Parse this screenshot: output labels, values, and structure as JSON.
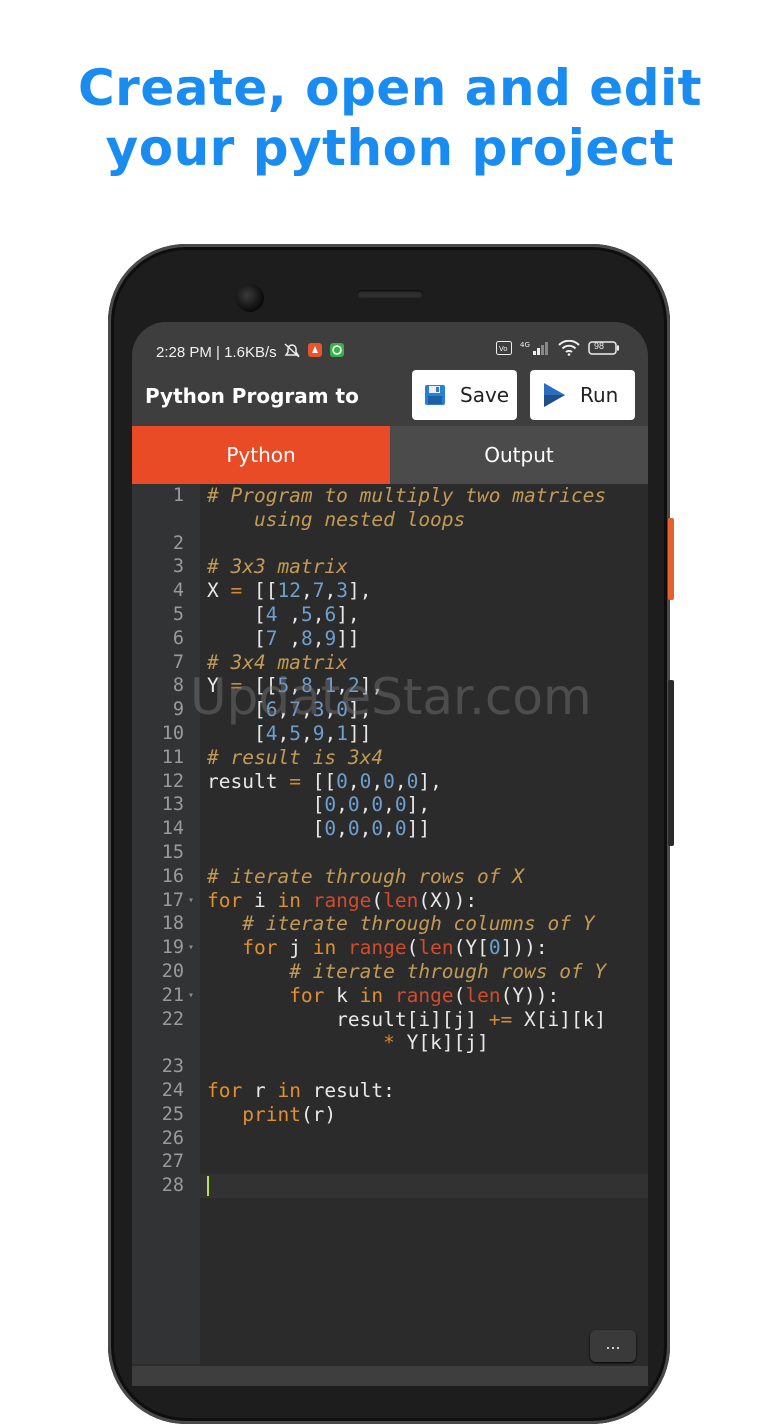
{
  "headline": {
    "line1": "Create, open and edit",
    "line2": "your python project"
  },
  "status_bar": {
    "time_speed": "2:28 PM | 1.6KB/s",
    "network": "4G",
    "battery": "98"
  },
  "toolbar": {
    "title": "Python Program to",
    "save_label": "Save",
    "run_label": "Run"
  },
  "tabs": {
    "python": "Python",
    "output": "Output"
  },
  "editor": {
    "line_numbers": [
      "1",
      "2",
      "3",
      "4",
      "5",
      "6",
      "7",
      "8",
      "9",
      "10",
      "11",
      "12",
      "13",
      "14",
      "15",
      "16",
      "17",
      "18",
      "19",
      "20",
      "21",
      "22",
      "23",
      "24",
      "25",
      "26",
      "27",
      "28"
    ],
    "more_label": "...",
    "code": {
      "l1a": "# Program to multiply two matrices",
      "l1b": "    using nested loops",
      "l3": "# 3x3 matrix",
      "l7": "# 3x4 matrix",
      "l11": "# result is 3x4",
      "l16": "# iterate through rows of X",
      "l18": "# iterate through columns of Y",
      "l20": "# iterate through rows of Y"
    }
  },
  "watermark": "UpdateStar.com",
  "colors": {
    "headline": "#1a8cf0",
    "tab_active": "#e84b25",
    "comment": "#c29a55",
    "keyword": "#e0902c",
    "number": "#6e9fcf",
    "builtin": "#d24b2c"
  },
  "icons": [
    "do-not-disturb-icon",
    "notification-icon",
    "chat-icon",
    "volte-icon",
    "signal-icon",
    "wifi-icon",
    "battery-icon",
    "save-icon",
    "run-icon"
  ]
}
